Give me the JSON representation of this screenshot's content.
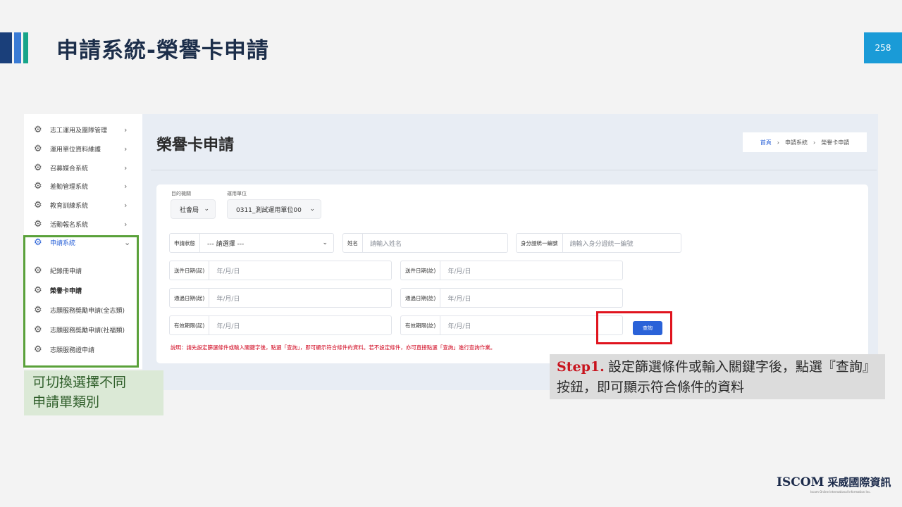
{
  "slide": {
    "title": "申請系統-榮譽卡申請",
    "page_number": "258",
    "colors": {
      "title": "#1c2e4a",
      "page_badge": "#1a9bd7",
      "highlight_red": "#e0141e",
      "highlight_green": "#5aa13a"
    }
  },
  "sidebar": {
    "items": [
      {
        "label": "志工運用及團隊管理",
        "icon": "gear-icon",
        "chevron": "›"
      },
      {
        "label": "運用單位資料維護",
        "icon": "gear-icon",
        "chevron": "›"
      },
      {
        "label": "召募媒合系統",
        "icon": "gear-icon",
        "chevron": "›"
      },
      {
        "label": "差勤管理系統",
        "icon": "gear-icon",
        "chevron": "›"
      },
      {
        "label": "教育訓練系統",
        "icon": "gear-icon",
        "chevron": "›"
      },
      {
        "label": "活動報名系統",
        "icon": "gear-icon",
        "chevron": "›"
      },
      {
        "label": "申請系統",
        "icon": "gear-icon",
        "chevron": "⌄",
        "active": true
      }
    ],
    "sub_items": [
      {
        "label": "紀錄冊申請",
        "icon": "gear-icon"
      },
      {
        "label": "榮譽卡申請",
        "icon": "gear-icon",
        "selected": true
      },
      {
        "label": "志願服務獎勵申請(全志類)",
        "icon": "gear-icon"
      },
      {
        "label": "志願服務獎勵申請(社福類)",
        "icon": "gear-icon"
      },
      {
        "label": "志願服務證申請",
        "icon": "gear-icon"
      }
    ]
  },
  "main": {
    "title": "榮譽卡申請",
    "breadcrumb": {
      "home": "首頁",
      "sep1": "›",
      "level1": "申請系統",
      "sep2": "›",
      "level2": "榮譽卡申請"
    }
  },
  "filters": {
    "authority_label": "目的機關",
    "authority_value": "社會局",
    "unit_label": "運用單位",
    "unit_value": "0311_測試運用單位00",
    "status": {
      "label": "申請狀態",
      "value": "--- 請選擇 ---"
    },
    "name": {
      "label": "姓名",
      "placeholder": "請輸入姓名"
    },
    "id_number": {
      "label": "身分證統一編號",
      "placeholder": "請輸入身分證統一編號"
    },
    "apply_start": {
      "label": "送件日期(起)",
      "placeholder": "年/月/日"
    },
    "apply_end": {
      "label": "送件日期(訖)",
      "placeholder": "年/月/日"
    },
    "approve_start": {
      "label": "通過日期(起)",
      "placeholder": "年/月/日"
    },
    "approve_end": {
      "label": "通過日期(訖)",
      "placeholder": "年/月/日"
    },
    "valid_start": {
      "label": "有效期限(起)",
      "placeholder": "年/月/日"
    },
    "valid_end": {
      "label": "有效期限(訖)",
      "placeholder": "年/月/日"
    },
    "query_button": "查詢",
    "notice": "說明：請先設定篩選條件或輸入關鍵字後，點選「查詢」，即可顯示符合條件的資料。若不設定條件，亦可直接點選「查詢」進行查詢作業。"
  },
  "annotations": {
    "green_note": "可切換選擇不同\n申請單類別",
    "step_label": "Step1.",
    "step_text": "設定篩選條件或輸入關鍵字後，點選『查詢』按鈕，即可顯示符合條件的資料"
  },
  "footer": {
    "brand": "ISCOM",
    "brand_cn": "采威國際資訊",
    "brand_sub": "Iscom Online International Information Inc."
  }
}
